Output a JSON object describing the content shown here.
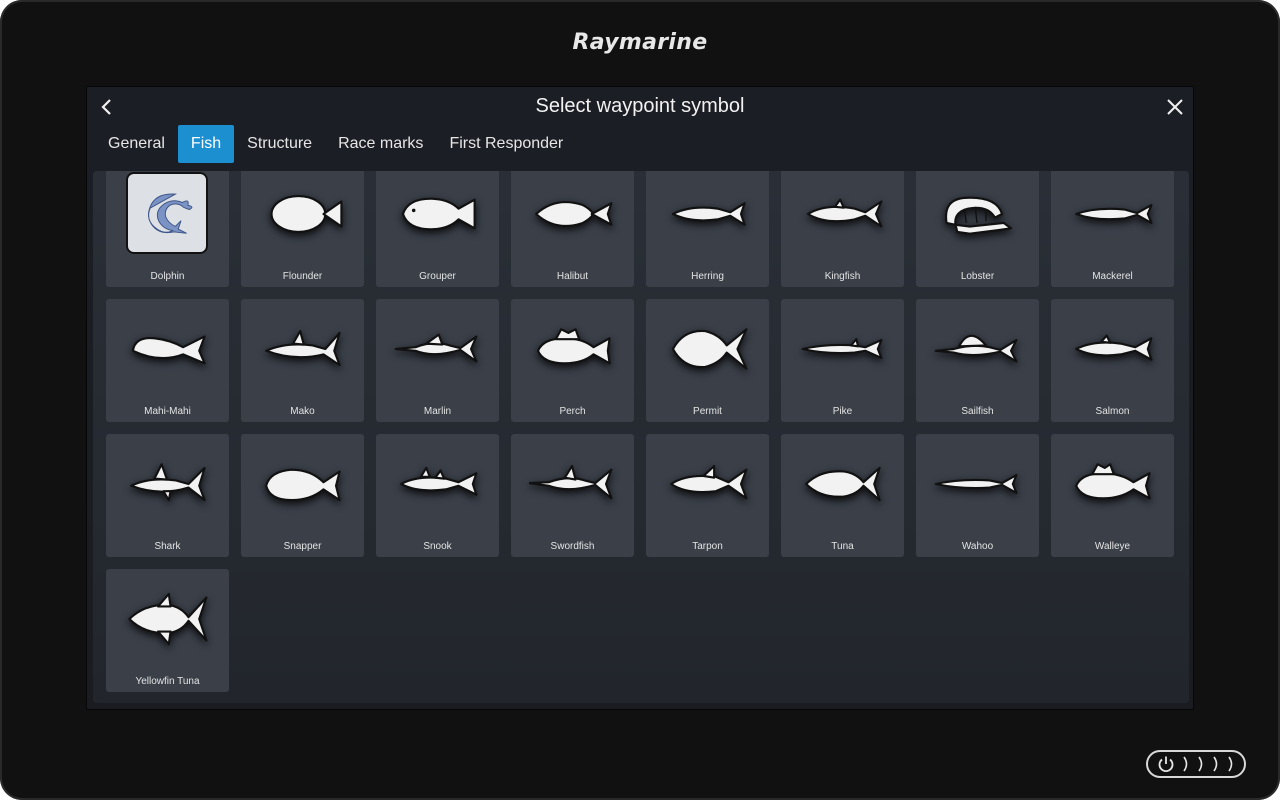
{
  "brand": "Raymarine",
  "dialog": {
    "title": "Select waypoint symbol",
    "back_icon": "chevron-left-icon",
    "close_icon": "close-icon"
  },
  "tabs": [
    {
      "label": "General",
      "active": false
    },
    {
      "label": "Fish",
      "active": true
    },
    {
      "label": "Structure",
      "active": false
    },
    {
      "label": "Race marks",
      "active": false
    },
    {
      "label": "First Responder",
      "active": false
    }
  ],
  "symbols": [
    {
      "label": "Dolphin",
      "icon": "dolphin-icon",
      "selected": true
    },
    {
      "label": "Flounder",
      "icon": "flounder-icon"
    },
    {
      "label": "Grouper",
      "icon": "grouper-icon"
    },
    {
      "label": "Halibut",
      "icon": "halibut-icon"
    },
    {
      "label": "Herring",
      "icon": "herring-icon"
    },
    {
      "label": "Kingfish",
      "icon": "kingfish-icon"
    },
    {
      "label": "Lobster",
      "icon": "lobster-icon"
    },
    {
      "label": "Mackerel",
      "icon": "mackerel-icon"
    },
    {
      "label": "Mahi-Mahi",
      "icon": "mahi-mahi-icon"
    },
    {
      "label": "Mako",
      "icon": "mako-icon"
    },
    {
      "label": "Marlin",
      "icon": "marlin-icon"
    },
    {
      "label": "Perch",
      "icon": "perch-icon"
    },
    {
      "label": "Permit",
      "icon": "permit-icon"
    },
    {
      "label": "Pike",
      "icon": "pike-icon"
    },
    {
      "label": "Sailfish",
      "icon": "sailfish-icon"
    },
    {
      "label": "Salmon",
      "icon": "salmon-icon"
    },
    {
      "label": "Shark",
      "icon": "shark-icon"
    },
    {
      "label": "Snapper",
      "icon": "snapper-icon"
    },
    {
      "label": "Snook",
      "icon": "snook-icon"
    },
    {
      "label": "Swordfish",
      "icon": "swordfish-icon"
    },
    {
      "label": "Tarpon",
      "icon": "tarpon-icon"
    },
    {
      "label": "Tuna",
      "icon": "tuna-icon"
    },
    {
      "label": "Wahoo",
      "icon": "wahoo-icon"
    },
    {
      "label": "Walleye",
      "icon": "walleye-icon"
    },
    {
      "label": "Yellowfin Tuna",
      "icon": "yellowfin-tuna-icon"
    }
  ],
  "colors": {
    "accent": "#1b8fd0",
    "tile": "#3a3f48",
    "icon_fill": "#f2f2f2",
    "icon_outline": "#111111"
  },
  "power_button": {
    "icon": "power-icon"
  }
}
